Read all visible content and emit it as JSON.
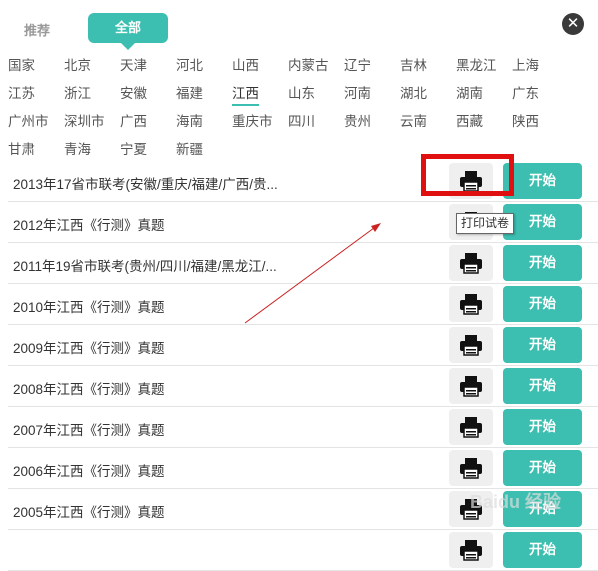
{
  "tabs": {
    "recommended": "推荐",
    "all": "全部"
  },
  "close_label": "✕",
  "regions": [
    "国家",
    "北京",
    "天津",
    "河北",
    "山西",
    "内蒙古",
    "辽宁",
    "吉林",
    "黑龙江",
    "上海",
    "江苏",
    "浙江",
    "安徽",
    "福建",
    "江西",
    "山东",
    "河南",
    "湖北",
    "湖南",
    "广东",
    "广州市",
    "深圳市",
    "广西",
    "海南",
    "重庆市",
    "四川",
    "贵州",
    "云南",
    "西藏",
    "陕西",
    "甘肃",
    "青海",
    "宁夏",
    "新疆"
  ],
  "active_region": "江西",
  "papers": [
    {
      "title": "2013年17省市联考(安徽/重庆/福建/广西/贵...",
      "start": "开始"
    },
    {
      "title": "2012年江西《行测》真题",
      "start": "开始"
    },
    {
      "title": "2011年19省市联考(贵州/四川/福建/黑龙江/...",
      "start": "开始"
    },
    {
      "title": "2010年江西《行测》真题",
      "start": "开始"
    },
    {
      "title": "2009年江西《行测》真题",
      "start": "开始"
    },
    {
      "title": "2008年江西《行测》真题",
      "start": "开始"
    },
    {
      "title": "2007年江西《行测》真题",
      "start": "开始"
    },
    {
      "title": "2006年江西《行测》真题",
      "start": "开始"
    },
    {
      "title": "2005年江西《行测》真题",
      "start": "开始"
    },
    {
      "title": "",
      "start": "开始"
    }
  ],
  "tooltip": "打印试卷",
  "watermark": "Baidu 经验",
  "colors": {
    "accent": "#3cbfb0",
    "highlight": "#e01010",
    "arrow": "#cc2222"
  }
}
